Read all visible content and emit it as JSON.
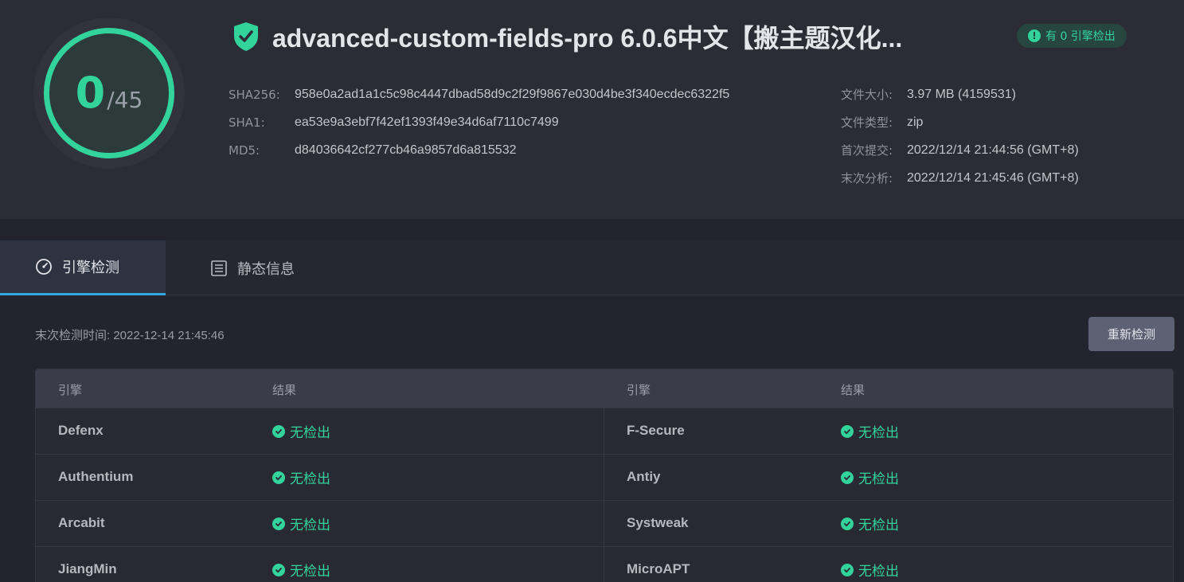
{
  "summary": {
    "score": "0",
    "total": "/45",
    "title": "advanced-custom-fields-pro 6.0.6中文【搬主题汉化...",
    "badge": "有 0 引擎检出",
    "hashes": [
      {
        "label": "SHA256:",
        "value": "958e0a2ad1a1c5c98c4447dbad58d9c2f29f9867e030d4be3f340ecdec6322f5"
      },
      {
        "label": "SHA1:",
        "value": "ea53e9a3ebf7f42ef1393f49e34d6af7110c7499"
      },
      {
        "label": "MD5:",
        "value": "d84036642cf277cb46a9857d6a815532"
      }
    ],
    "meta": [
      {
        "label": "文件大小:",
        "value": "3.97 MB (4159531)"
      },
      {
        "label": "文件类型:",
        "value": "zip"
      },
      {
        "label": "首次提交:",
        "value": "2022/12/14 21:44:56 (GMT+8)"
      },
      {
        "label": "末次分析:",
        "value": "2022/12/14 21:45:46 (GMT+8)"
      }
    ]
  },
  "tabs": [
    {
      "label": "引擎检测",
      "icon": "gauge-icon",
      "active": true
    },
    {
      "label": "静态信息",
      "icon": "list-icon",
      "active": false
    }
  ],
  "scan": {
    "last_scan": "末次检测时间: 2022-12-14 21:45:46",
    "rescan_label": "重新检测"
  },
  "table": {
    "headers": [
      "引擎",
      "结果",
      "引擎",
      "结果"
    ],
    "rows": [
      {
        "left_engine": "Defenx",
        "left_result": "无检出",
        "right_engine": "F-Secure",
        "right_result": "无检出"
      },
      {
        "left_engine": "Authentium",
        "left_result": "无检出",
        "right_engine": "Antiy",
        "right_result": "无检出"
      },
      {
        "left_engine": "Arcabit",
        "left_result": "无检出",
        "right_engine": "Systweak",
        "right_result": "无检出"
      },
      {
        "left_engine": "JiangMin",
        "left_result": "无检出",
        "right_engine": "MicroAPT",
        "right_result": "无检出"
      }
    ]
  },
  "colors": {
    "accent_green": "#33d39c",
    "tab_accent": "#35a7e0",
    "background": "#23242d"
  }
}
